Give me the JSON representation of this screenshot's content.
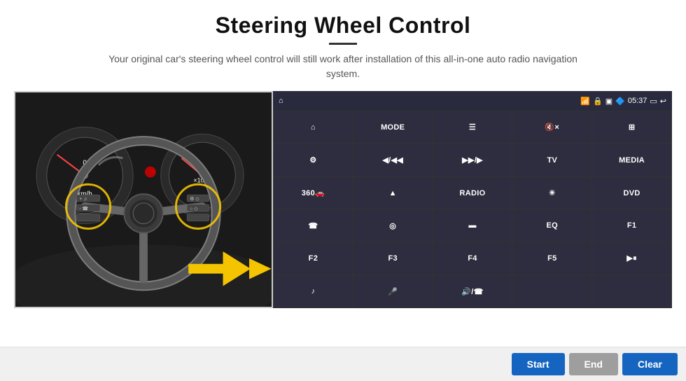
{
  "header": {
    "title": "Steering Wheel Control",
    "divider": true,
    "subtitle": "Your original car's steering wheel control will still work after installation of this all-in-one auto radio navigation system."
  },
  "status_bar": {
    "time": "05:37",
    "icons": [
      "wifi",
      "lock",
      "sd",
      "bluetooth",
      "screen",
      "back"
    ]
  },
  "button_grid": [
    {
      "id": "nav",
      "label": "▲",
      "icon": true,
      "text": "⌂"
    },
    {
      "id": "mode",
      "label": "MODE",
      "icon": false,
      "text": "MODE"
    },
    {
      "id": "menu",
      "label": "≡",
      "icon": true,
      "text": "☰"
    },
    {
      "id": "mute",
      "label": "🔇×",
      "icon": true,
      "text": "🔇×"
    },
    {
      "id": "apps",
      "label": "⊞",
      "icon": true,
      "text": "⊞"
    },
    {
      "id": "settings",
      "label": "⚙",
      "icon": true,
      "text": "⚙"
    },
    {
      "id": "prev",
      "label": "⏮",
      "icon": true,
      "text": "◀/◀◀"
    },
    {
      "id": "next",
      "label": "⏭",
      "icon": true,
      "text": "▶▶/▶"
    },
    {
      "id": "tv",
      "label": "TV",
      "icon": false,
      "text": "TV"
    },
    {
      "id": "media",
      "label": "MEDIA",
      "icon": false,
      "text": "MEDIA"
    },
    {
      "id": "cam360",
      "label": "360",
      "icon": true,
      "text": "360🚗"
    },
    {
      "id": "eject",
      "label": "⏏",
      "icon": true,
      "text": "▲"
    },
    {
      "id": "radio",
      "label": "RADIO",
      "icon": false,
      "text": "RADIO"
    },
    {
      "id": "brightness",
      "label": "☀",
      "icon": true,
      "text": "☀"
    },
    {
      "id": "dvd",
      "label": "DVD",
      "icon": false,
      "text": "DVD"
    },
    {
      "id": "phone",
      "label": "📞",
      "icon": true,
      "text": "☎"
    },
    {
      "id": "browse",
      "label": "🌀",
      "icon": true,
      "text": "◎"
    },
    {
      "id": "screen",
      "label": "⬜",
      "icon": true,
      "text": "▬"
    },
    {
      "id": "eq",
      "label": "EQ",
      "icon": false,
      "text": "EQ"
    },
    {
      "id": "f1",
      "label": "F1",
      "icon": false,
      "text": "F1"
    },
    {
      "id": "f2",
      "label": "F2",
      "icon": false,
      "text": "F2"
    },
    {
      "id": "f3",
      "label": "F3",
      "icon": false,
      "text": "F3"
    },
    {
      "id": "f4",
      "label": "F4",
      "icon": false,
      "text": "F4"
    },
    {
      "id": "f5",
      "label": "F5",
      "icon": false,
      "text": "F5"
    },
    {
      "id": "playpause",
      "label": "▶⏸",
      "icon": true,
      "text": "▶⏸"
    },
    {
      "id": "music",
      "label": "🎵",
      "icon": true,
      "text": "♪"
    },
    {
      "id": "mic",
      "label": "🎤",
      "icon": true,
      "text": "🎤"
    },
    {
      "id": "vol",
      "label": "🔊",
      "icon": true,
      "text": "🔊/☎"
    },
    {
      "id": "empty1",
      "label": "",
      "icon": false,
      "text": ""
    },
    {
      "id": "empty2",
      "label": "",
      "icon": false,
      "text": ""
    }
  ],
  "actions": {
    "start_label": "Start",
    "end_label": "End",
    "clear_label": "Clear"
  },
  "colors": {
    "panel_bg": "#1e1e2e",
    "status_bg": "#2a2a3e",
    "btn_bg": "#2d2d3f",
    "btn_hover": "#3a3a52",
    "grid_gap": "#111",
    "start_btn": "#1565c0",
    "end_btn": "#9e9e9e",
    "clear_btn": "#1565c0",
    "action_bar_bg": "#f0f0f0"
  }
}
